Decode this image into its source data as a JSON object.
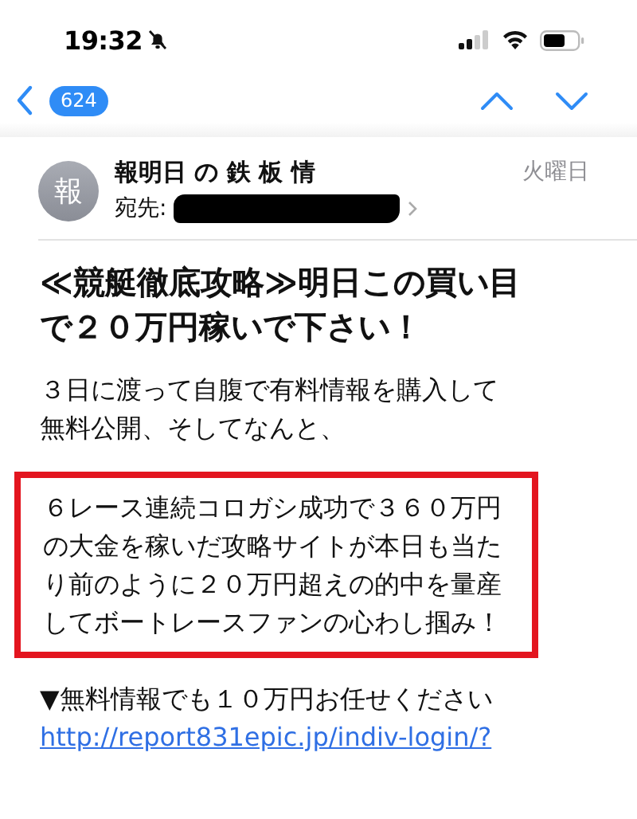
{
  "status_bar": {
    "time": "19:32",
    "silenced": true
  },
  "nav": {
    "unread_count": "624"
  },
  "message": {
    "avatar": "報",
    "sender": "報明日 の 鉄 板 情",
    "date": "火曜日",
    "to_label": "宛先:",
    "recipient_redacted": true
  },
  "subject": "≪競艇徹底攻略≫明日この買い目で２０万円稼いで下さい！",
  "body": [
    {
      "kind": "text",
      "text": "３日に渡って自腹で有料情報を購入して無料公開、そしてなんと、"
    },
    {
      "kind": "highlight",
      "text": "６レース連続コロガシ成功で３６０万円の大金を稼いだ攻略サイトが本日も当たり前のように２０万円超えの的中を量産してボートレースファンの心わし掴み！"
    },
    {
      "kind": "text",
      "text": "▼無料情報でも１０万円お任せください"
    },
    {
      "kind": "link",
      "text": "http://report831epic.jp/indiv-login/?"
    }
  ]
}
